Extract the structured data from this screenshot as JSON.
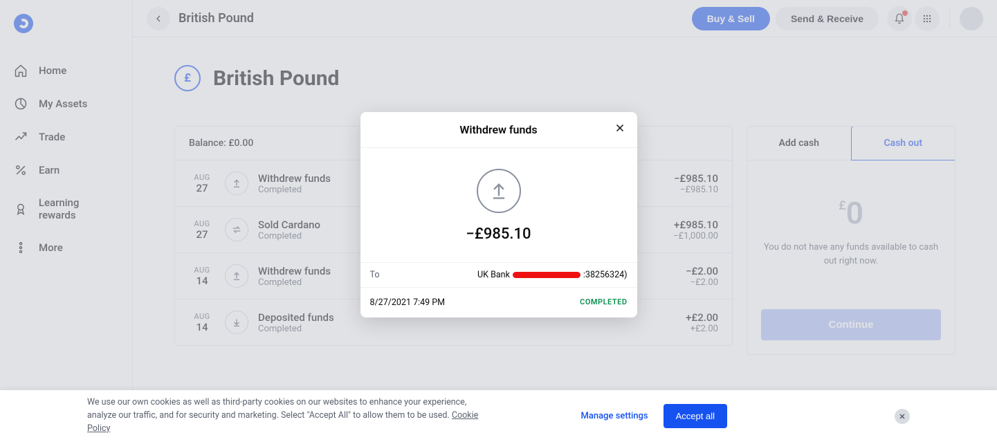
{
  "sidebar": {
    "items": [
      {
        "label": "Home"
      },
      {
        "label": "My Assets"
      },
      {
        "label": "Trade"
      },
      {
        "label": "Earn"
      },
      {
        "label": "Learning rewards"
      },
      {
        "label": "More"
      }
    ]
  },
  "topbar": {
    "title": "British Pound",
    "buy_sell": "Buy & Sell",
    "send_receive": "Send & Receive"
  },
  "page": {
    "currency_symbol": "£",
    "title": "British Pound",
    "balance_label": "Balance: £0.00"
  },
  "transactions": [
    {
      "month": "AUG",
      "day": "27",
      "icon": "withdraw",
      "title": "Withdrew funds",
      "sub": "Completed",
      "amt1": "−£985.10",
      "amt2": "−£985.10"
    },
    {
      "month": "AUG",
      "day": "27",
      "icon": "swap",
      "title": "Sold Cardano",
      "sub": "Completed",
      "amt1": "+£985.10",
      "amt2": "−£1,000.00"
    },
    {
      "month": "AUG",
      "day": "14",
      "icon": "withdraw",
      "title": "Withdrew funds",
      "sub": "Completed",
      "amt1": "−£2.00",
      "amt2": "−£2.00"
    },
    {
      "month": "AUG",
      "day": "14",
      "icon": "deposit",
      "title": "Deposited funds",
      "sub": "Completed",
      "amt1": "+£2.00",
      "amt2": "+£2.00"
    }
  ],
  "sidepanel": {
    "tab_add": "Add cash",
    "tab_cashout": "Cash out",
    "currency": "£",
    "amount": "0",
    "msg": "You do not have any funds available to cash out right now.",
    "continue": "Continue"
  },
  "modal": {
    "title": "Withdrew funds",
    "amount": "−£985.10",
    "to_label": "To",
    "to_value_prefix": "UK Bank",
    "to_value_suffix": ":38256324)",
    "datetime": "8/27/2021 7:49 PM",
    "status": "COMPLETED"
  },
  "cookiebar": {
    "text": "We use our own cookies as well as third-party cookies on our websites to enhance your experience, analyze our traffic, and for security and marketing. Select \"Accept All\" to allow them to be used. ",
    "policy": "Cookie Policy",
    "manage": "Manage settings",
    "accept": "Accept all"
  }
}
